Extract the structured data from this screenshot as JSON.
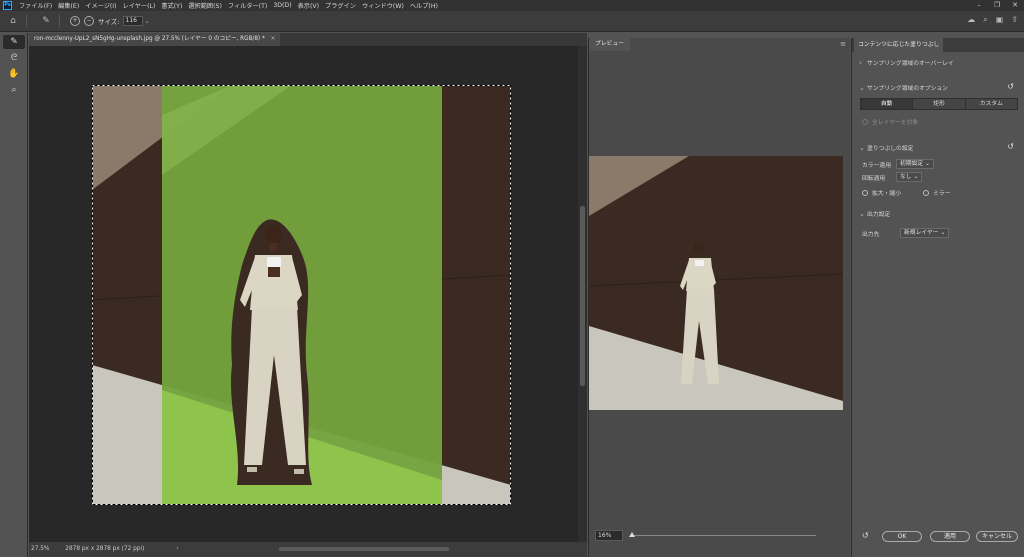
{
  "menubar": {
    "items": [
      "ファイル(F)",
      "編集(E)",
      "イメージ(I)",
      "レイヤー(L)",
      "書式(Y)",
      "選択範囲(S)",
      "フィルター(T)",
      "3D(D)",
      "表示(V)",
      "プラグイン",
      "ウィンドウ(W)",
      "ヘルプ(H)"
    ]
  },
  "options": {
    "size_label": "サイズ:",
    "size_value": "116"
  },
  "document": {
    "tab_title": "ron-mcclenny-UpL2_sN5gHg-unsplash.jpg @ 27.5% (レイヤー 0 のコピー, RGB/8) *",
    "zoom": "27.5%",
    "dimensions": "2878 px x 2878 px (72 ppi)"
  },
  "preview": {
    "tab_label": "プレビュー",
    "zoom_value": "16%"
  },
  "caf": {
    "tab_label": "コンテンツに応じた塗りつぶし",
    "sampling_overlay": "サンプリング領域のオーバーレイ",
    "sampling_options": "サンプリング領域のオプション",
    "segments": [
      "自動",
      "矩形",
      "カスタム"
    ],
    "sample_all_layers": "全レイヤーを対象",
    "fill_settings": "塗りつぶしの設定",
    "color_adapt_label": "カラー適用",
    "color_adapt_value": "初期設定",
    "rotation_label": "回転適用",
    "rotation_value": "なし",
    "scale_label": "拡大・縮小",
    "mirror_label": "ミラー",
    "output_settings": "出力設定",
    "output_to_label": "出力先",
    "output_to_value": "新規レイヤー",
    "ok": "OK",
    "apply": "適用",
    "cancel": "キャンセル"
  },
  "colors": {
    "wall_dark": "#3a2a22",
    "fill_green": "#74a33c",
    "suit": "#d8d3c2",
    "ground": "#c9c6be"
  }
}
